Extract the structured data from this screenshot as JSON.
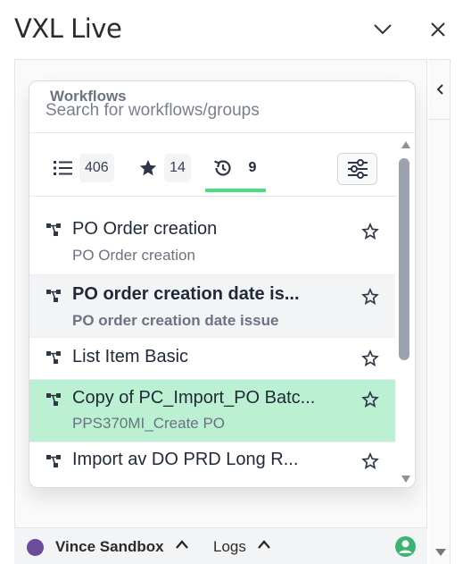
{
  "app": {
    "title": "VXL Live"
  },
  "search": {
    "label": "Workflows",
    "placeholder": "Search for workflows/groups"
  },
  "tabs": [
    {
      "name": "all",
      "icon": "list-icon",
      "count": "406"
    },
    {
      "name": "favorites",
      "icon": "star-filled-icon",
      "count": "14"
    },
    {
      "name": "recent",
      "icon": "history-icon",
      "count": "9",
      "active": true
    }
  ],
  "workflows": [
    {
      "title": "PO Order creation",
      "subtitle": "PO Order creation",
      "bold": false,
      "highlight": ""
    },
    {
      "title": "PO order creation date is...",
      "subtitle": "PO order creation date issue",
      "bold": true,
      "highlight": "#f3f4f6"
    },
    {
      "title": "List Item Basic",
      "subtitle": "",
      "bold": false,
      "highlight": ""
    },
    {
      "title": "Copy of PC_Import_PO Batc...",
      "subtitle": "PPS370MI_Create PO",
      "bold": false,
      "highlight": "#bbf0d2"
    },
    {
      "title": "Import av DO PRD Long R...",
      "subtitle": "",
      "bold": false,
      "highlight": ""
    }
  ],
  "footer": {
    "environment": "Vince Sandbox",
    "logs": "Logs"
  },
  "colors": {
    "accent": "#4ade80",
    "selected_row": "#bbf0d2",
    "environment_dot": "#6b4b9a",
    "user_icon": "#3cb371"
  }
}
